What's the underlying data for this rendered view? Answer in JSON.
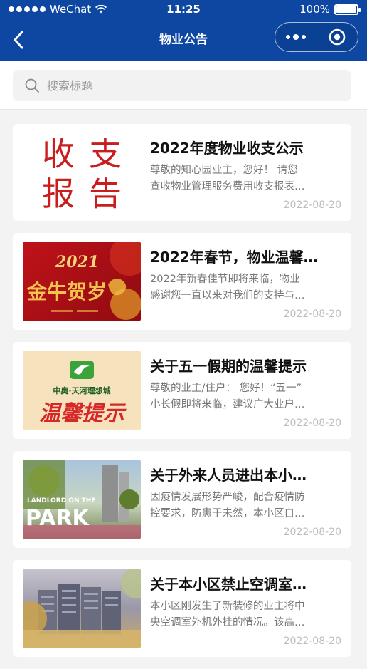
{
  "status_bar": {
    "carrier": "WeChat",
    "time": "11:25",
    "battery": "100%",
    "battery_level": 1.0
  },
  "nav": {
    "title": "物业公告"
  },
  "search": {
    "placeholder": "搜索标题"
  },
  "thumb_text": {
    "report": [
      "收",
      "支",
      "报",
      "告"
    ],
    "newyear_year": "2021",
    "newyear_text": "金牛贺岁",
    "notice_brand": "中奥·天河理想城",
    "notice_text": "温馨提示",
    "park_sign": "LANDLORD ON THE",
    "park_text": "PARK"
  },
  "announcements": [
    {
      "title": "2022年度物业收支公示",
      "desc_line1": "尊敬的知心园业主，您好！ 请您",
      "desc_line2": "查收物业管理服务费用收支报表…",
      "date": "2022-08-20"
    },
    {
      "title": "2022年春节，物业温馨…",
      "desc_line1": "2022年新春佳节即将来临，物业",
      "desc_line2": "感谢您一直以来对我们的支持与…",
      "date": "2022-08-20"
    },
    {
      "title": "关于五一假期的温馨提示",
      "desc_line1": "尊敬的业主/住户： 您好！“五一”",
      "desc_line2": "小长假即将来临，建议广大业户…",
      "date": "2022-08-20"
    },
    {
      "title": "关于外来人员进出本小…",
      "desc_line1": "因疫情发展形势严峻，配合疫情防",
      "desc_line2": "控要求，防患于未然，本小区自…",
      "date": "2022-08-20"
    },
    {
      "title": "关于本小区禁止空调室…",
      "desc_line1": "本小区刚发生了新装修的业主将中",
      "desc_line2": "央空调室外机外挂的情况。该高…",
      "date": "2022-08-20"
    }
  ],
  "colors": {
    "nav_bg": "#0d47a1",
    "report_red": "#c81e1e"
  }
}
